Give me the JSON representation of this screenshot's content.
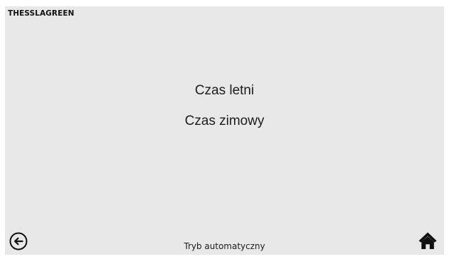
{
  "header": {
    "brand": "THESSLAGREEN"
  },
  "menu": {
    "items": [
      {
        "label": "Czas letni"
      },
      {
        "label": "Czas zimowy"
      }
    ]
  },
  "footer": {
    "status": "Tryb automatyczny",
    "back_icon": "back-arrow-circle-icon",
    "home_icon": "home-icon"
  },
  "colors": {
    "background": "#e8e8e8",
    "text": "#1a1a1a"
  }
}
